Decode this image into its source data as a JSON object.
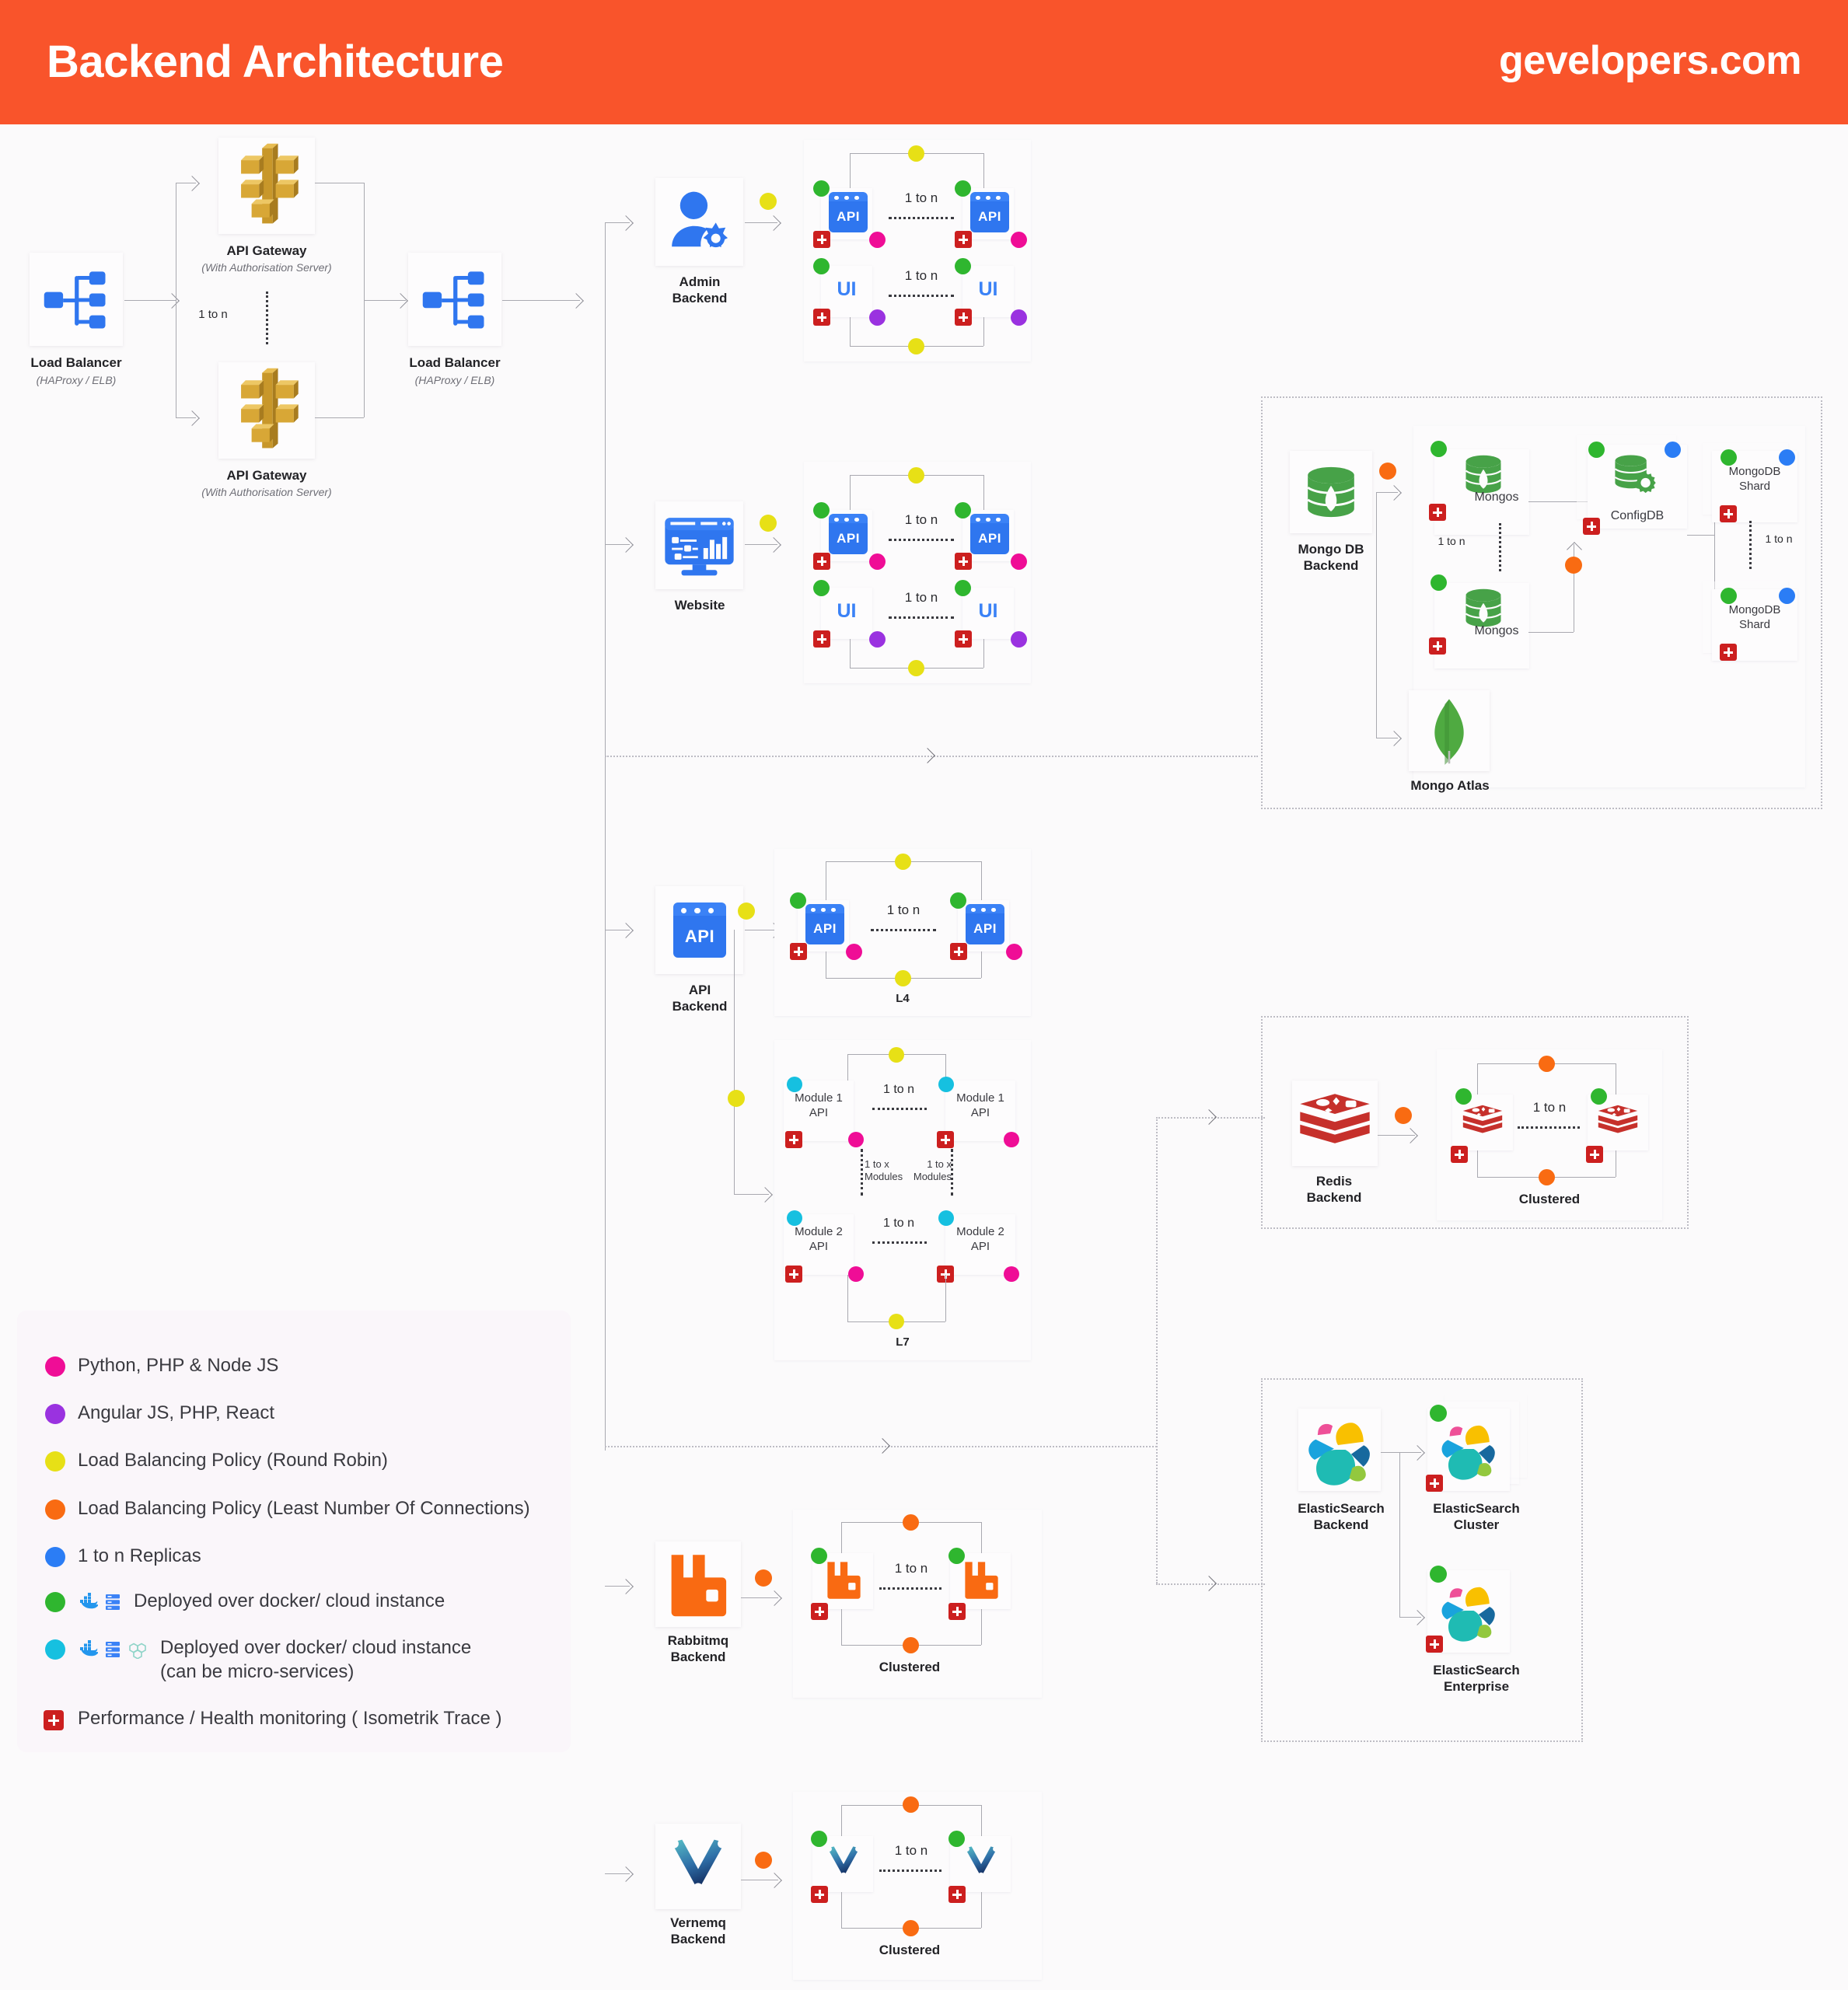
{
  "header": {
    "title": "Backend Architecture",
    "brand": "gevelopers.com",
    "bg": "#f9542b",
    "fg": "#ffffff"
  },
  "colors": {
    "magenta": "#ef0d96",
    "purple": "#9a32e0",
    "yellow": "#e7e016",
    "orange": "#f96b12",
    "blue": "#2b7df5",
    "green": "#2fb62f",
    "cyan": "#16c0e0",
    "red_badge": "#cc1f1f"
  },
  "entry": {
    "load_balancer_left": {
      "title": "Load Balancer",
      "subtitle": "(HAProxy / ELB)"
    },
    "api_gateway_top": {
      "title": "API Gateway",
      "subtitle": "(With Authorisation Server)"
    },
    "api_gateway_bottom": {
      "title": "API Gateway",
      "subtitle": "(With Authorisation Server)"
    },
    "gateway_replicas": "1 to n",
    "load_balancer_right": {
      "title": "Load Balancer",
      "subtitle": "(HAProxy / ELB)"
    }
  },
  "admin": {
    "backend_label": "Admin\nBackend",
    "api_label": "API",
    "ui_label": "UI",
    "api_replicas": "1 to n",
    "ui_replicas": "1 to n"
  },
  "website": {
    "backend_label": "Website",
    "api_label": "API",
    "ui_label": "UI",
    "api_replicas": "1 to n",
    "ui_replicas": "1 to n"
  },
  "api_backend": {
    "backend_label": "API\nBackend",
    "api_label": "API",
    "l4_label": "L4",
    "l4_replicas": "1 to n"
  },
  "l7": {
    "title": "L7",
    "module1_label": "Module 1\nAPI",
    "module2_label": "Module 2\nAPI",
    "module1_replicas": "1 to n",
    "module2_replicas": "1 to n",
    "modules_left": "1 to x\nModules",
    "modules_right": "1 to x\nModules"
  },
  "mongo": {
    "backend_label": "Mongo DB\nBackend",
    "mongos_top": "Mongos",
    "mongos_bottom": "Mongos",
    "mongos_replicas": "1 to n",
    "configdb": "ConfigDB",
    "shard_top": "MongoDB\nShard",
    "shard_bottom": "MongoDB\nShard",
    "shard_replicas": "1 to n",
    "atlas": "Mongo Atlas"
  },
  "redis": {
    "backend_label": "Redis\nBackend",
    "cluster_label": "Clustered",
    "replicas": "1 to n"
  },
  "elastic": {
    "backend_label": "ElasticSearch\nBackend",
    "cluster_label": "ElasticSearch\nCluster",
    "enterprise_label": "ElasticSearch\nEnterprise"
  },
  "rabbitmq": {
    "backend_label": "Rabbitmq\nBackend",
    "cluster_label": "Clustered",
    "replicas": "1 to n"
  },
  "vernemq": {
    "backend_label": "Vernemq\nBackend",
    "cluster_label": "Clustered",
    "replicas": "1 to n"
  },
  "legend": {
    "items": [
      {
        "color": "#ef0d96",
        "kind": "dot",
        "text": "Python, PHP & Node JS"
      },
      {
        "color": "#9a32e0",
        "kind": "dot",
        "text": "Angular JS, PHP, React"
      },
      {
        "color": "#e7e016",
        "kind": "dot",
        "text": "Load Balancing Policy (Round Robin)"
      },
      {
        "color": "#f96b12",
        "kind": "dot",
        "text": "Load Balancing Policy (Least Number Of Connections)"
      },
      {
        "color": "#2b7df5",
        "kind": "dot",
        "text": "1 to n Replicas"
      },
      {
        "color": "#2fb62f",
        "kind": "dot",
        "text": "Deployed over docker/ cloud instance",
        "icons": [
          "docker-icon",
          "server-icon"
        ]
      },
      {
        "color": "#16c0e0",
        "kind": "dot",
        "text": "Deployed over docker/ cloud instance\n(can be micro-services)",
        "icons": [
          "docker-icon",
          "server-icon",
          "kubernetes-icon"
        ]
      },
      {
        "color": "#cc1f1f",
        "kind": "plus",
        "text": "Performance / Health monitoring ( Isometrik Trace )"
      }
    ]
  }
}
